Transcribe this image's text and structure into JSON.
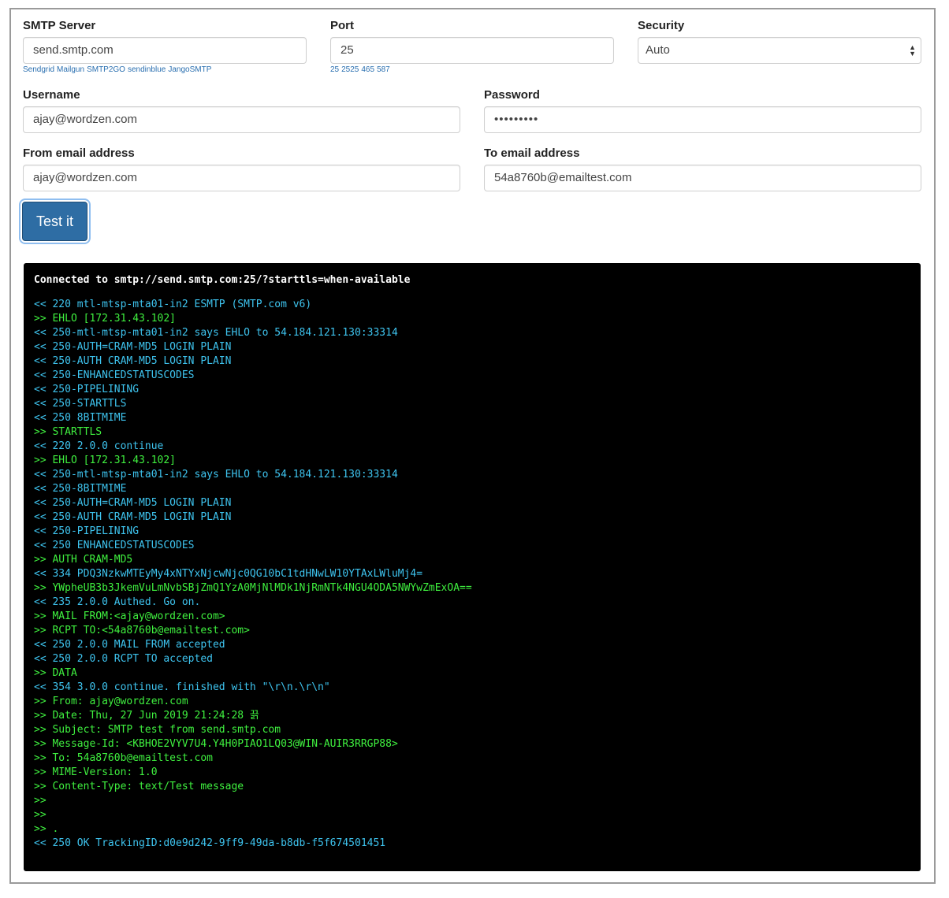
{
  "form": {
    "smtp_server": {
      "label": "SMTP Server",
      "value": "send.smtp.com",
      "suggestions": [
        "Sendgrid",
        "Mailgun",
        "SMTP2GO",
        "sendinblue",
        "JangoSMTP"
      ]
    },
    "port": {
      "label": "Port",
      "value": "25",
      "suggestions": [
        "25",
        "2525",
        "465",
        "587"
      ]
    },
    "security": {
      "label": "Security",
      "value": "Auto"
    },
    "username": {
      "label": "Username",
      "value": "ajay@wordzen.com"
    },
    "password": {
      "label": "Password",
      "value": "•••••••••"
    },
    "from_email": {
      "label": "From email address",
      "value": "ajay@wordzen.com"
    },
    "to_email": {
      "label": "To email address",
      "value": "54a8760b@emailtest.com"
    },
    "test_button_label": "Test it"
  },
  "console": {
    "header": "Connected to smtp://send.smtp.com:25/?starttls=when-available",
    "colors": {
      "in": "#3ec4ef",
      "out": "#3ff03f",
      "header": "#ffffff",
      "background": "#000000"
    },
    "lines": [
      {
        "dir": "in",
        "text": "<< 220 mtl-mtsp-mta01-in2 ESMTP (SMTP.com v6)"
      },
      {
        "dir": "out",
        "text": ">> EHLO [172.31.43.102]"
      },
      {
        "dir": "in",
        "text": "<< 250-mtl-mtsp-mta01-in2 says EHLO to 54.184.121.130:33314"
      },
      {
        "dir": "in",
        "text": "<< 250-AUTH=CRAM-MD5 LOGIN PLAIN"
      },
      {
        "dir": "in",
        "text": "<< 250-AUTH CRAM-MD5 LOGIN PLAIN"
      },
      {
        "dir": "in",
        "text": "<< 250-ENHANCEDSTATUSCODES"
      },
      {
        "dir": "in",
        "text": "<< 250-PIPELINING"
      },
      {
        "dir": "in",
        "text": "<< 250-STARTTLS"
      },
      {
        "dir": "in",
        "text": "<< 250 8BITMIME"
      },
      {
        "dir": "out",
        "text": ">> STARTTLS"
      },
      {
        "dir": "in",
        "text": "<< 220 2.0.0 continue"
      },
      {
        "dir": "out",
        "text": ">> EHLO [172.31.43.102]"
      },
      {
        "dir": "in",
        "text": "<< 250-mtl-mtsp-mta01-in2 says EHLO to 54.184.121.130:33314"
      },
      {
        "dir": "in",
        "text": "<< 250-8BITMIME"
      },
      {
        "dir": "in",
        "text": "<< 250-AUTH=CRAM-MD5 LOGIN PLAIN"
      },
      {
        "dir": "in",
        "text": "<< 250-AUTH CRAM-MD5 LOGIN PLAIN"
      },
      {
        "dir": "in",
        "text": "<< 250-PIPELINING"
      },
      {
        "dir": "in",
        "text": "<< 250 ENHANCEDSTATUSCODES"
      },
      {
        "dir": "out",
        "text": ">> AUTH CRAM-MD5"
      },
      {
        "dir": "in",
        "text": "<< 334 PDQ3NzkwMTEyMy4xNTYxNjcwNjc0QG10bC1tdHNwLW10YTAxLWluMj4="
      },
      {
        "dir": "out",
        "text": ">> YWpheUB3b3JkemVuLmNvbSBjZmQ1YzA0MjNlMDk1NjRmNTk4NGU4ODA5NWYwZmExOA=="
      },
      {
        "dir": "in",
        "text": "<< 235 2.0.0 Authed. Go on."
      },
      {
        "dir": "out",
        "text": ">> MAIL FROM:<ajay@wordzen.com>"
      },
      {
        "dir": "out",
        "text": ">> RCPT TO:<54a8760b@emailtest.com>"
      },
      {
        "dir": "in",
        "text": "<< 250 2.0.0 MAIL FROM accepted"
      },
      {
        "dir": "in",
        "text": "<< 250 2.0.0 RCPT TO accepted"
      },
      {
        "dir": "out",
        "text": ">> DATA"
      },
      {
        "dir": "in",
        "text": "<< 354 3.0.0 continue. finished with \"\\r\\n.\\r\\n\""
      },
      {
        "dir": "out",
        "text": ">> From: ajay@wordzen.com"
      },
      {
        "dir": "out",
        "text": ">> Date: Thu, 27 Jun 2019 21:24:28 끍"
      },
      {
        "dir": "out",
        "text": ">> Subject: SMTP test from send.smtp.com"
      },
      {
        "dir": "out",
        "text": ">> Message-Id: <KBHOE2VYV7U4.Y4H0PIAO1LQ03@WIN-AUIR3RRGP88>"
      },
      {
        "dir": "out",
        "text": ">> To: 54a8760b@emailtest.com"
      },
      {
        "dir": "out",
        "text": ">> MIME-Version: 1.0"
      },
      {
        "dir": "out",
        "text": ">> Content-Type: text/Test message"
      },
      {
        "dir": "out",
        "text": ">>"
      },
      {
        "dir": "out",
        "text": ">>"
      },
      {
        "dir": "out",
        "text": ">> ."
      },
      {
        "dir": "in",
        "text": "<< 250 OK TrackingID:d0e9d242-9ff9-49da-b8db-f5f674501451"
      }
    ]
  }
}
